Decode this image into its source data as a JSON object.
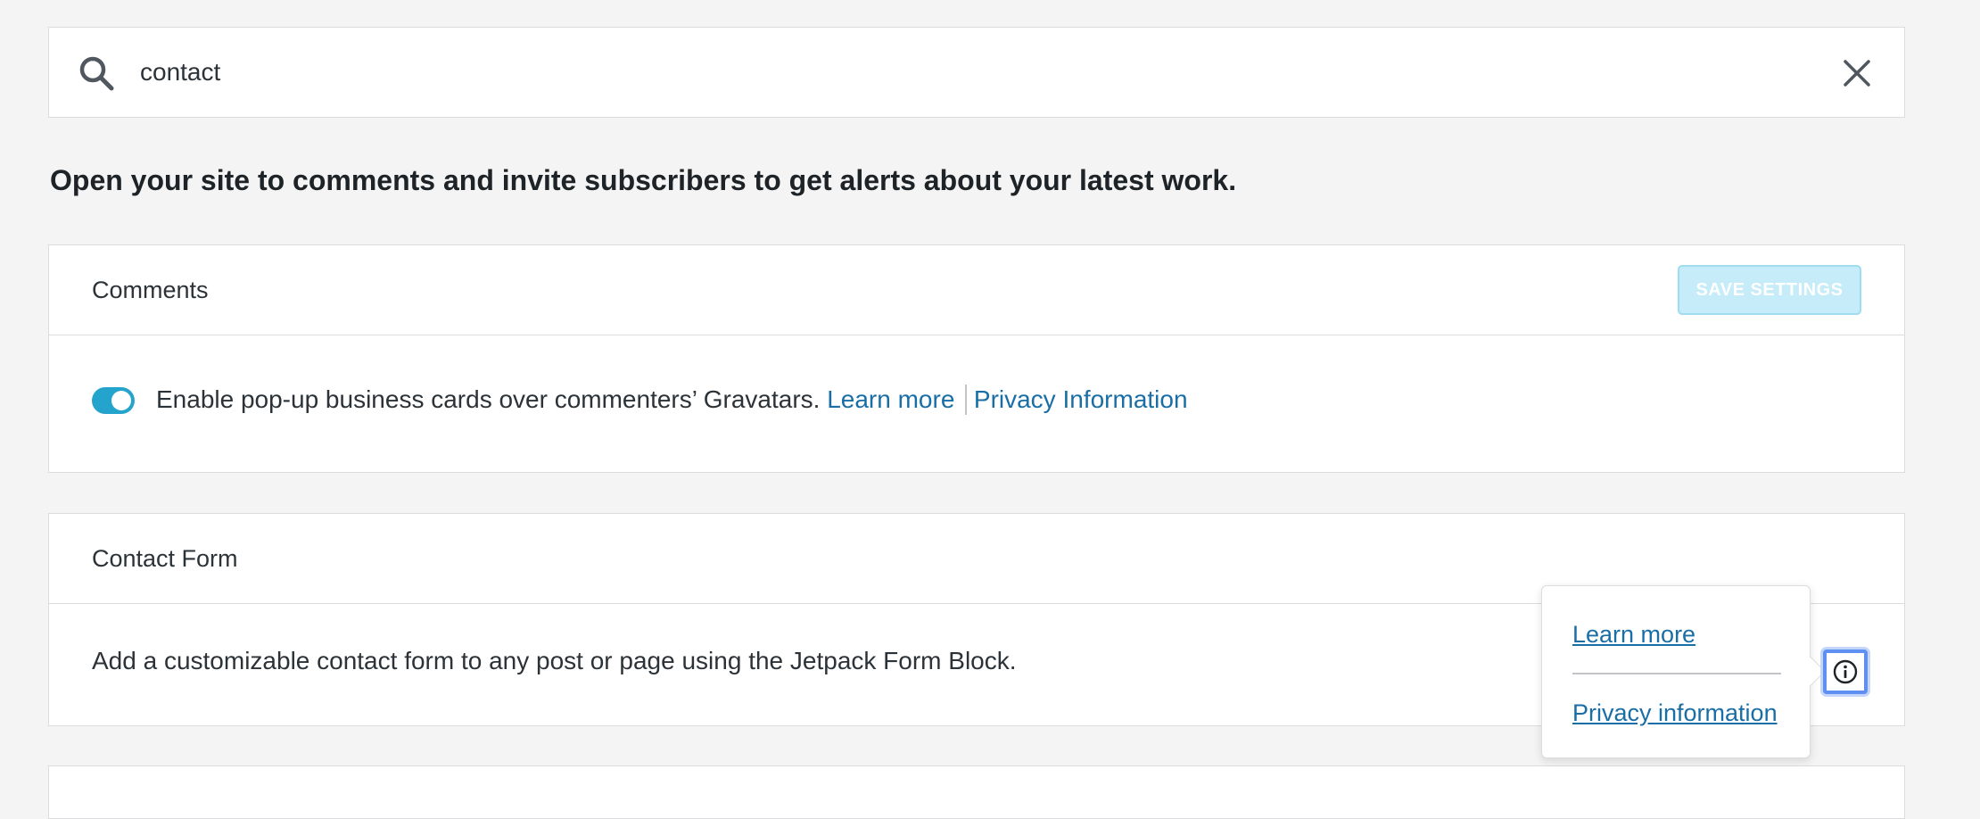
{
  "search": {
    "value": "contact",
    "icon": "search-icon",
    "clear_icon": "close-icon"
  },
  "intro_text": "Open your site to comments and invite subscribers to get alerts about your latest work.",
  "comments_card": {
    "title": "Comments",
    "save_label": "SAVE SETTINGS",
    "toggle_on": true,
    "setting_text": "Enable pop-up business cards over commenters’ Gravatars.",
    "learn_more": "Learn more",
    "privacy": "Privacy Information"
  },
  "contact_form_card": {
    "title": "Contact Form",
    "description": "Add a customizable contact form to any post or page using the Jetpack Form Block.",
    "info_icon": "info-icon"
  },
  "popover": {
    "learn_more": "Learn more",
    "privacy": "Privacy information"
  },
  "colors": {
    "accent": "#24a4cc",
    "link": "#1a6ea6",
    "save_disabled_bg": "#c5ecf8",
    "focus_ring": "#5f8ff0"
  }
}
